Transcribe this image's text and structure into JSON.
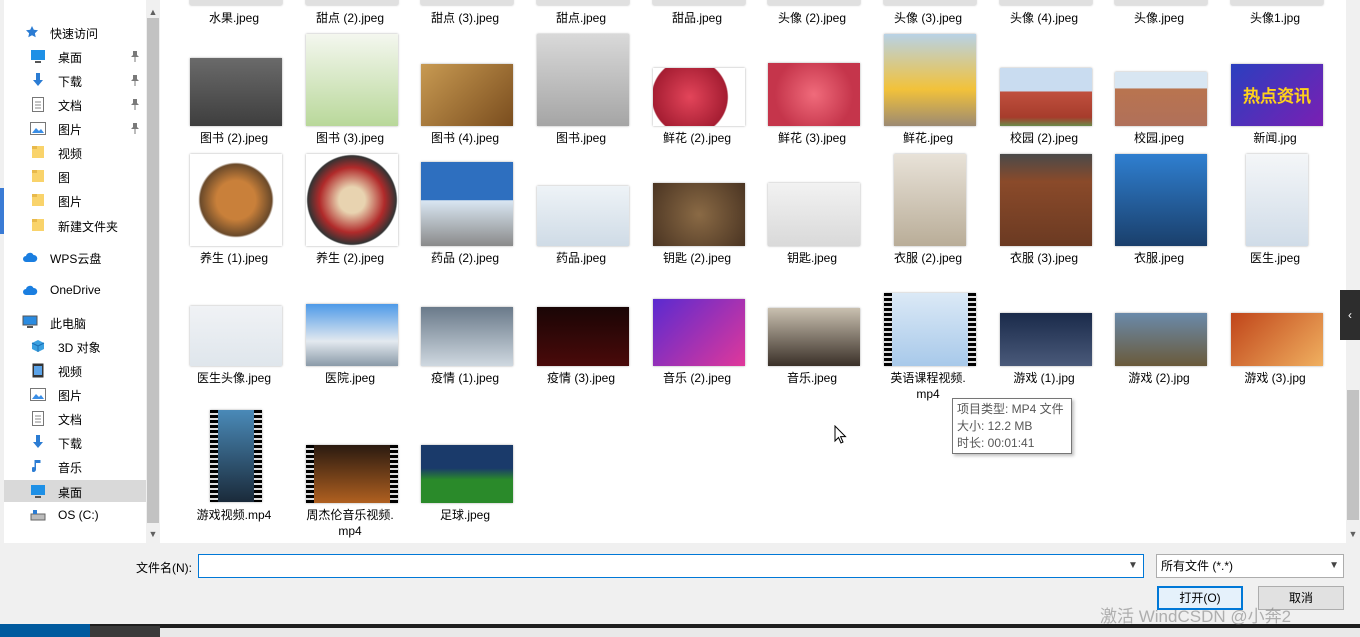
{
  "nav": {
    "items": [
      {
        "label": "快速访问",
        "icon": "star-icon"
      },
      {
        "label": "桌面",
        "icon": "desktop-icon"
      },
      {
        "label": "下载",
        "icon": "download-icon"
      },
      {
        "label": "文档",
        "icon": "document-icon"
      },
      {
        "label": "图片",
        "icon": "pictures-icon"
      },
      {
        "label": "视频",
        "icon": "folder-icon"
      },
      {
        "label": "图",
        "icon": "folder-icon"
      },
      {
        "label": "图片",
        "icon": "folder-icon"
      },
      {
        "label": "新建文件夹",
        "icon": "folder-icon"
      },
      {
        "label": "WPS云盘",
        "icon": "cloud-icon"
      },
      {
        "label": "OneDrive",
        "icon": "cloud-icon"
      },
      {
        "label": "此电脑",
        "icon": "computer-icon"
      },
      {
        "label": "3D 对象",
        "icon": "cube-icon"
      },
      {
        "label": "视频",
        "icon": "video-icon"
      },
      {
        "label": "图片",
        "icon": "pictures-icon"
      },
      {
        "label": "文档",
        "icon": "document-icon"
      },
      {
        "label": "下载",
        "icon": "download-icon"
      },
      {
        "label": "音乐",
        "icon": "music-icon"
      },
      {
        "label": "桌面",
        "icon": "desktop-icon"
      },
      {
        "label": "OS (C:)",
        "icon": "drive-icon"
      }
    ]
  },
  "files": {
    "row0": [
      "水果.jpeg",
      "甜点 (2).jpeg",
      "甜点 (3).jpeg",
      "甜点.jpeg",
      "甜品.jpeg",
      "头像 (2).jpeg",
      "头像 (3).jpeg",
      "头像 (4).jpeg",
      "头像.jpeg",
      "头像1.jpg"
    ],
    "row1": [
      "图书 (2).jpeg",
      "图书 (3).jpeg",
      "图书 (4).jpeg",
      "图书.jpeg",
      "鲜花 (2).jpeg",
      "鲜花 (3).jpeg",
      "鲜花.jpeg",
      "校园 (2).jpeg",
      "校园.jpeg",
      "新闻.jpg"
    ],
    "row2": [
      "养生 (1).jpeg",
      "养生 (2).jpeg",
      "药品 (2).jpeg",
      "药品.jpeg",
      "钥匙 (2).jpeg",
      "钥匙.jpeg",
      "衣服 (2).jpeg",
      "衣服 (3).jpeg",
      "衣服.jpeg",
      "医生.jpeg"
    ],
    "row3": [
      "医生头像.jpeg",
      "医院.jpeg",
      "疫情 (1).jpeg",
      "疫情 (3).jpeg",
      "音乐 (2).jpeg",
      "音乐.jpeg",
      "英语课程视频.\nmp4",
      "游戏 (1).jpg",
      "游戏 (2).jpg",
      "游戏 (3).jpg"
    ],
    "row4": [
      "游戏视频.mp4",
      "周杰伦音乐视频.\nmp4",
      "足球.jpeg"
    ]
  },
  "thumb_text": {
    "news": "热点资讯"
  },
  "tooltip": {
    "type": "项目类型: MP4 文件",
    "size": "大小: 12.2 MB",
    "duration": "时长: 00:01:41"
  },
  "footer": {
    "filename_label": "文件名(N):",
    "filename_value": "",
    "filetype_value": "所有文件 (*.*)",
    "open_label": "打开(O)",
    "cancel_label": "取消"
  },
  "watermark": "激活 WindCSDN @小奔2",
  "colors": {
    "accent": "#0078d7",
    "selected": "#d9d9d9"
  }
}
